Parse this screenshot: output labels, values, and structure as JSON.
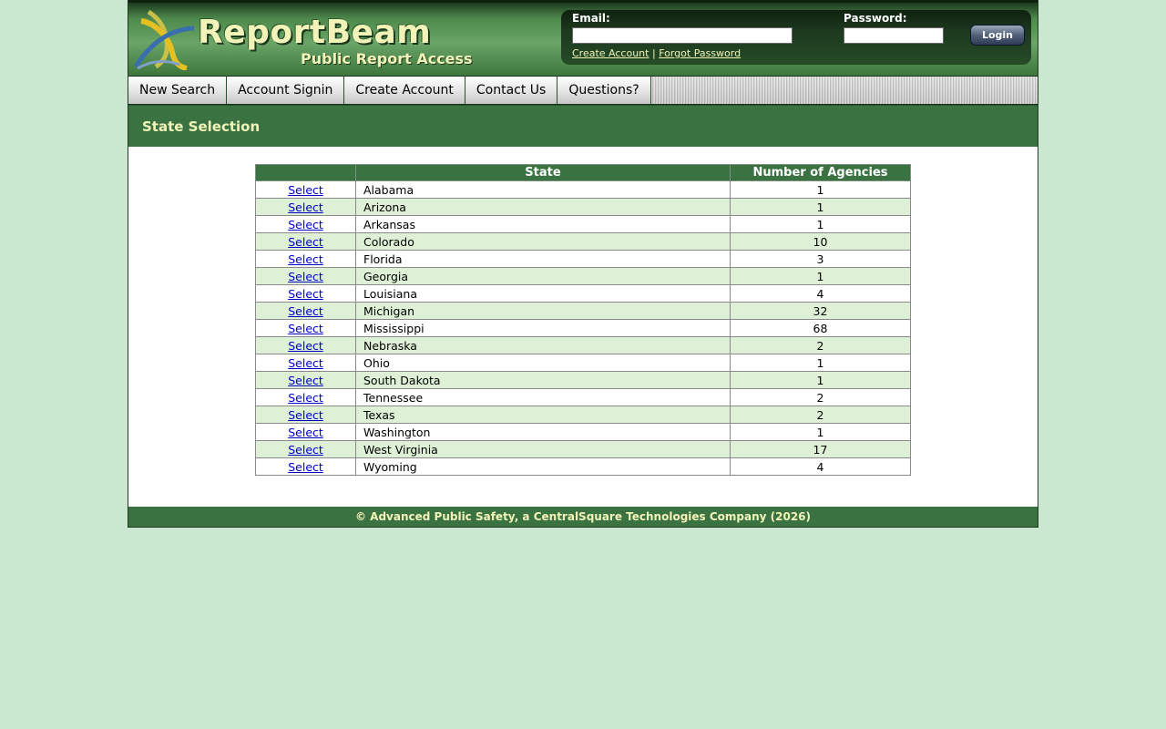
{
  "header": {
    "brand_title": "ReportBeam",
    "brand_subtitle": "Public Report Access",
    "login": {
      "email_label": "Email:",
      "email_value": "",
      "password_label": "Password:",
      "password_value": "",
      "login_button": "Login",
      "create_account_link": "Create Account",
      "separator": "|",
      "forgot_password_link": "Forgot Password"
    }
  },
  "nav": {
    "items": [
      {
        "label": "New Search"
      },
      {
        "label": "Account Signin"
      },
      {
        "label": "Create Account"
      },
      {
        "label": "Contact Us"
      },
      {
        "label": "Questions?"
      }
    ]
  },
  "page": {
    "title": "State Selection"
  },
  "table": {
    "columns": [
      "",
      "State",
      "Number of Agencies"
    ],
    "rows": [
      {
        "action": "Select",
        "state": "Alabama",
        "agencies": "1"
      },
      {
        "action": "Select",
        "state": "Arizona",
        "agencies": "1"
      },
      {
        "action": "Select",
        "state": "Arkansas",
        "agencies": "1"
      },
      {
        "action": "Select",
        "state": "Colorado",
        "agencies": "10"
      },
      {
        "action": "Select",
        "state": "Florida",
        "agencies": "3"
      },
      {
        "action": "Select",
        "state": "Georgia",
        "agencies": "1"
      },
      {
        "action": "Select",
        "state": "Louisiana",
        "agencies": "4"
      },
      {
        "action": "Select",
        "state": "Michigan",
        "agencies": "32"
      },
      {
        "action": "Select",
        "state": "Mississippi",
        "agencies": "68"
      },
      {
        "action": "Select",
        "state": "Nebraska",
        "agencies": "2"
      },
      {
        "action": "Select",
        "state": "Ohio",
        "agencies": "1"
      },
      {
        "action": "Select",
        "state": "South Dakota",
        "agencies": "1"
      },
      {
        "action": "Select",
        "state": "Tennessee",
        "agencies": "2"
      },
      {
        "action": "Select",
        "state": "Texas",
        "agencies": "2"
      },
      {
        "action": "Select",
        "state": "Washington",
        "agencies": "1"
      },
      {
        "action": "Select",
        "state": "West Virginia",
        "agencies": "17"
      },
      {
        "action": "Select",
        "state": "Wyoming",
        "agencies": "4"
      }
    ]
  },
  "footer": {
    "copyright": "© Advanced Public Safety, a CentralSquare Technologies Company (2026)"
  },
  "colors": {
    "page_background": "#cae7cf",
    "header_green": "#3b7242",
    "brand_text": "#f2f3b8",
    "row_alt": "#def1d6",
    "link": "#0000c8"
  },
  "icons": {
    "logo": "reportbeam-logo-icon"
  }
}
